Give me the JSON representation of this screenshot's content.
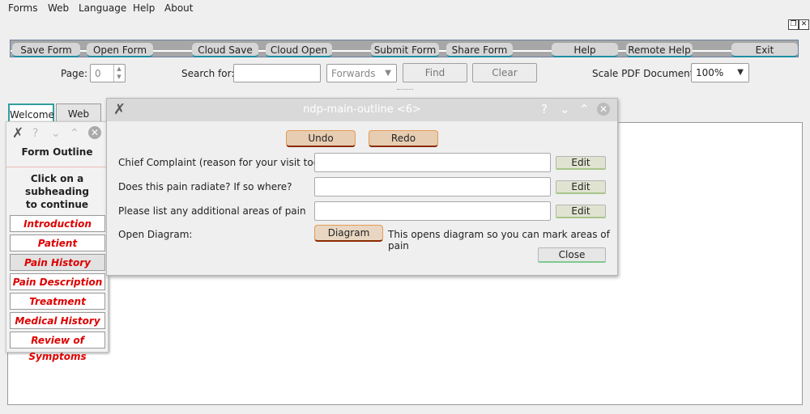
{
  "menu": {
    "items": [
      "Forms",
      "Web",
      "Language",
      "Help",
      "About"
    ]
  },
  "toolbar": {
    "buttons": [
      "Save Form",
      "Open Form",
      "Cloud Save",
      "Cloud Open",
      "Submit Form",
      "Share Form",
      "Help",
      "Remote Help",
      "Exit"
    ]
  },
  "search_row": {
    "page_label": "Page:",
    "page_value": "0",
    "search_label": "Search for:",
    "search_value": "",
    "direction": "Forwards",
    "find_label": "Find",
    "clear_label": "Clear",
    "scale_label": "Scale PDF Document:",
    "scale_value": "100%"
  },
  "tabs": [
    "Welcome",
    "Web"
  ],
  "outline": {
    "title": "Form Outline",
    "hint_line1": "Click on a",
    "hint_line2": "subheading",
    "hint_line3": "to continue",
    "items": [
      "Introduction",
      "Patient Information",
      "Pain History",
      "Pain Description",
      "Treatment History",
      "Medical History",
      "Review of Symptoms"
    ],
    "selected": "Pain History"
  },
  "dialog": {
    "title": "ndp-main-outline <6>",
    "undo_label": "Undo",
    "redo_label": "Redo",
    "questions": [
      {
        "label": "Chief Complaint (reason for your visit today)",
        "value": "",
        "edit_label": "Edit"
      },
      {
        "label": "Does this pain radiate?  If so where?",
        "value": "",
        "edit_label": "Edit"
      },
      {
        "label": "Please list any additional areas of pain",
        "value": "",
        "edit_label": "Edit"
      }
    ],
    "diagram_label": "Open Diagram:",
    "diagram_button": "Diagram",
    "diagram_note": "This opens diagram so you can mark areas of pain",
    "close_label": "Close"
  },
  "colors": {
    "accent": "#1e8fa3",
    "nav_text": "#dd0000",
    "orange": "#e59a55"
  }
}
